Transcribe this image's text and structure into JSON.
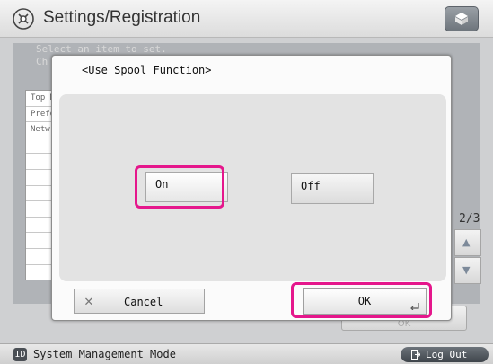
{
  "header": {
    "title": "Settings/Registration",
    "settings_icon": "settings-gear-icon",
    "counter_icon": "counter-check-icon"
  },
  "background": {
    "hint_lines": [
      "Select an item to set.",
      "Ch"
    ],
    "list_items": [
      "Top M",
      "Prefe",
      "Netw",
      "",
      "",
      "",
      "",
      "",
      "",
      "",
      "",
      ""
    ],
    "page_indicator": "2/3",
    "scroll_up_icon": "triangle-up-icon",
    "scroll_down_icon": "triangle-down-icon",
    "ok_label": "OK"
  },
  "dialog": {
    "title": "<Use Spool Function>",
    "options": [
      {
        "label": "On",
        "selected": true
      },
      {
        "label": "Off",
        "selected": false
      }
    ],
    "cancel_label": "Cancel",
    "ok_label": "OK"
  },
  "status_bar": {
    "mode_icon_text": "ID",
    "mode_text": "System Management Mode",
    "logout_label": "Log Out"
  },
  "colors": {
    "highlight": "#e5178c",
    "background": "#cfd0d2"
  }
}
